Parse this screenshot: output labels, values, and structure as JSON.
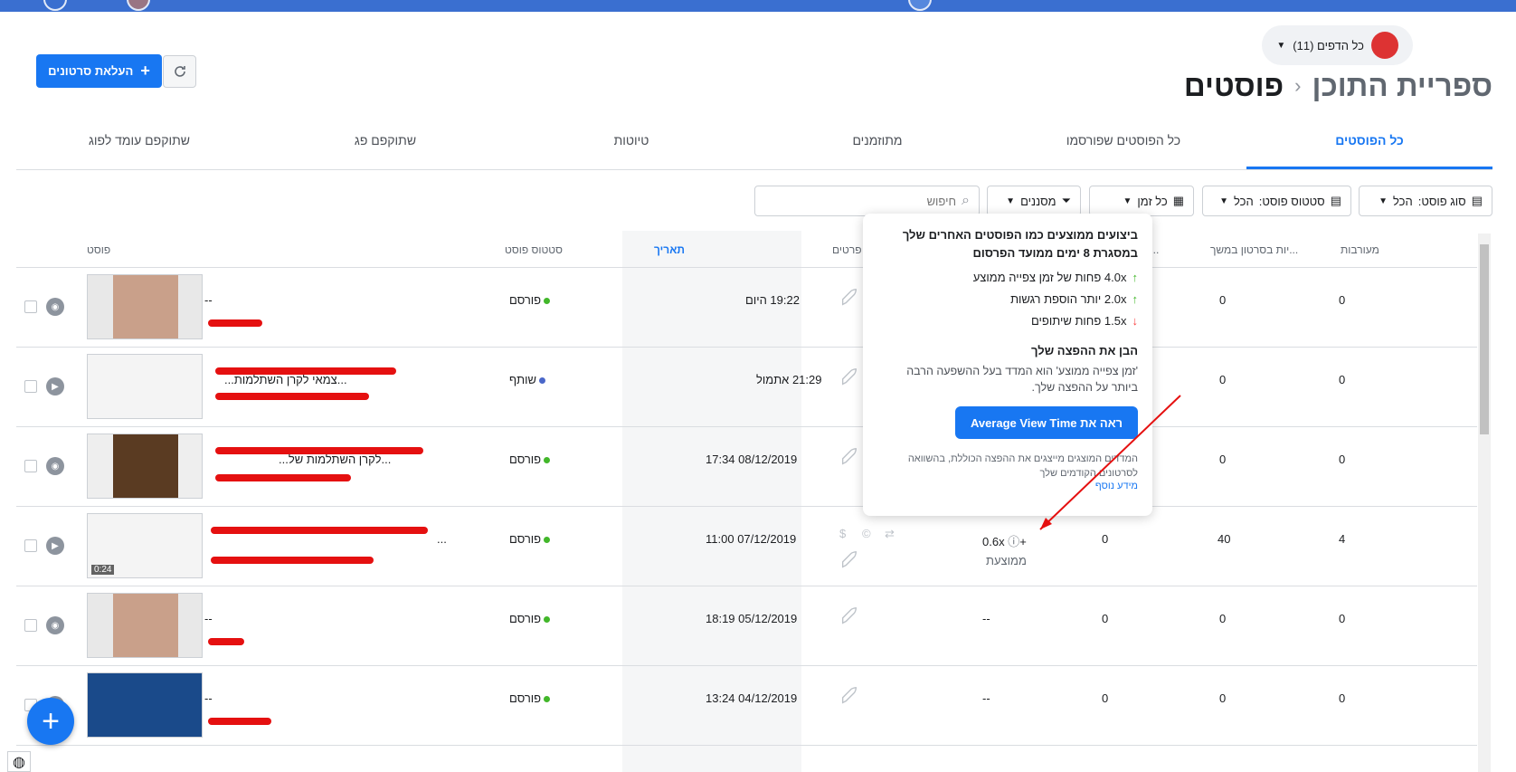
{
  "header": {
    "page_switch_label": "כל הדפים (11)",
    "upload_label": "העלאת סרטונים",
    "title_library": "ספריית התוכן",
    "title_separator": "‹",
    "title_current": "פוסטים"
  },
  "tabs": [
    "כל הפוסטים",
    "כל הפוסטים שפורסמו",
    "מתוזמנים",
    "טיוטות",
    "שתוקפם פג",
    "שתוקפם עומד לפוג"
  ],
  "filters": {
    "post_type_label": "סוג פוסט:",
    "post_type_value": "הכל",
    "post_status_label": "סטטוס פוסט:",
    "post_status_value": "הכל",
    "time_value": "כל זמן",
    "filters_label": "מסננים",
    "search_placeholder": "חיפוש"
  },
  "columns": {
    "post": "פוסט",
    "status": "סטטוס פוסט",
    "date": "תאריך",
    "details": "פרטים",
    "col_avg": "...יות בכ",
    "col_retention": "...יות בסרטון במשך",
    "col_engagement": "מעורבות"
  },
  "rows": [
    {
      "title": "--",
      "status": "פורסם",
      "status_color": "#42b72a",
      "date": "19:22 היום",
      "avg": "",
      "avg_sub": "",
      "c1": "",
      "c2": "0",
      "c3": "0",
      "type": "photo"
    },
    {
      "title": "...צמאי לקרן השתלמות...",
      "status": "שותף",
      "status_color": "#4a67c9",
      "date": "21:29 אתמול",
      "avg": "",
      "avg_sub": "",
      "c1": "",
      "c2": "0",
      "c3": "0",
      "type": "video"
    },
    {
      "title": "...לקרן השתלמות של...",
      "status": "פורסם",
      "status_color": "#42b72a",
      "date": "08/12/2019 17:34",
      "avg": "",
      "avg_sub": "",
      "c1": "",
      "c2": "0",
      "c3": "0",
      "type": "photo"
    },
    {
      "title": "...",
      "status": "פורסם",
      "status_color": "#42b72a",
      "date": "07/12/2019 11:00",
      "avg": "+0.6x",
      "avg_sub": "ממוצעת",
      "c1": "0",
      "c2": "40",
      "c3": "4",
      "type": "video",
      "duration": "0:24"
    },
    {
      "title": "--",
      "status": "פורסם",
      "status_color": "#42b72a",
      "date": "05/12/2019 18:19",
      "avg": "--",
      "avg_sub": "",
      "c1": "0",
      "c2": "0",
      "c3": "0",
      "type": "photo"
    },
    {
      "title": "--",
      "status": "פורסם",
      "status_color": "#42b72a",
      "date": "04/12/2019 13:24",
      "avg": "--",
      "avg_sub": "",
      "c1": "0",
      "c2": "0",
      "c3": "0",
      "type": "photo"
    }
  ],
  "popup": {
    "title": "ביצועים ממוצעים כמו הפוסטים האחרים שלך במסגרת 8 ימים ממועד הפרסום",
    "metrics": [
      {
        "value": "4.0x",
        "text": "פחות של זמן צפייה ממוצע",
        "dir": "up"
      },
      {
        "value": "2.0x",
        "text": "יותר הוספת רגשות",
        "dir": "up"
      },
      {
        "value": "1.5x",
        "text": "פחות שיתופים",
        "dir": "down"
      }
    ],
    "subtitle": "הבן את ההפצה שלך",
    "description": "'זמן צפייה ממוצע' הוא המדד בעל ההשפעה הרבה ביותר על ההפצה שלך.",
    "button": "ראה את Average View Time",
    "footnote": "המדדים המוצגים מייצגים את ההפצה הכוללת, בהשוואה לסרטונים הקודמים שלך",
    "more": "מידע נוסף"
  },
  "colors": {
    "accent": "#1877f2",
    "topbar": "#3a6fd0",
    "annotation": "#e51010"
  }
}
